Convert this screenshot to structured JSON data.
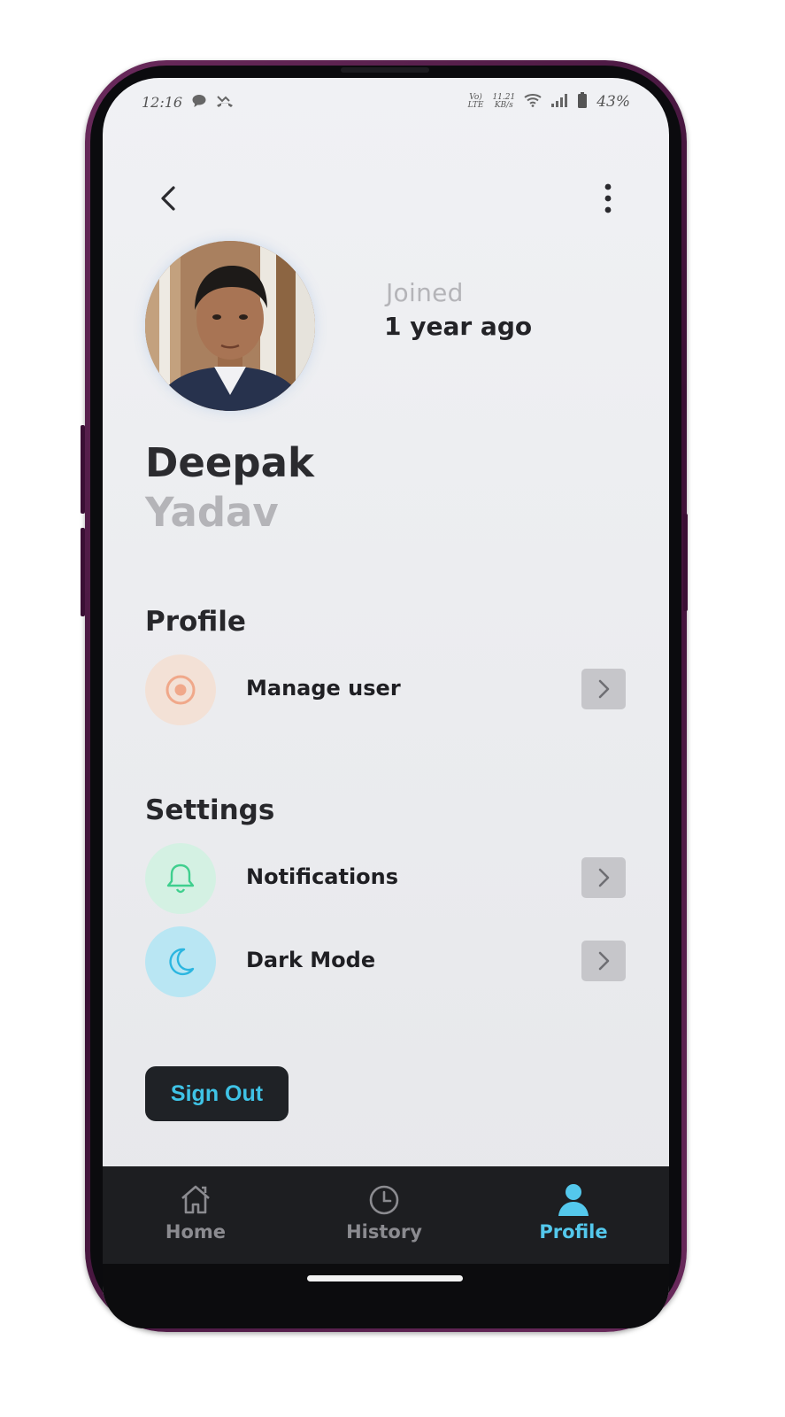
{
  "status_bar": {
    "time": "12:16",
    "left_icons": [
      "chat-bubble-icon",
      "missed-call-icon"
    ],
    "network_label_top": "Vo)",
    "network_label_bottom": "LTE",
    "speed_top": "11.21",
    "speed_bottom": "KB/s",
    "battery": "43%"
  },
  "header": {
    "back_icon": "chevron-left-icon",
    "more_icon": "more-vertical-icon"
  },
  "profile": {
    "joined_label": "Joined",
    "joined_value": "1 year ago",
    "first_name": "Deepak",
    "last_name": "Yadav"
  },
  "sections": {
    "profile_title": "Profile",
    "settings_title": "Settings"
  },
  "rows": {
    "manage_user": {
      "label": "Manage user",
      "icon": "target-icon",
      "color": "#f0a88a"
    },
    "notifications": {
      "label": "Notifications",
      "icon": "bell-icon",
      "color": "#3fcf8e"
    },
    "dark_mode": {
      "label": "Dark Mode",
      "icon": "moon-icon",
      "color": "#2cb6e0"
    }
  },
  "sign_out_label": "Sign Out",
  "nav": {
    "home": "Home",
    "history": "History",
    "profile": "Profile",
    "active": "Profile",
    "active_color": "#54c8ec",
    "inactive_color": "#8b8b90"
  }
}
